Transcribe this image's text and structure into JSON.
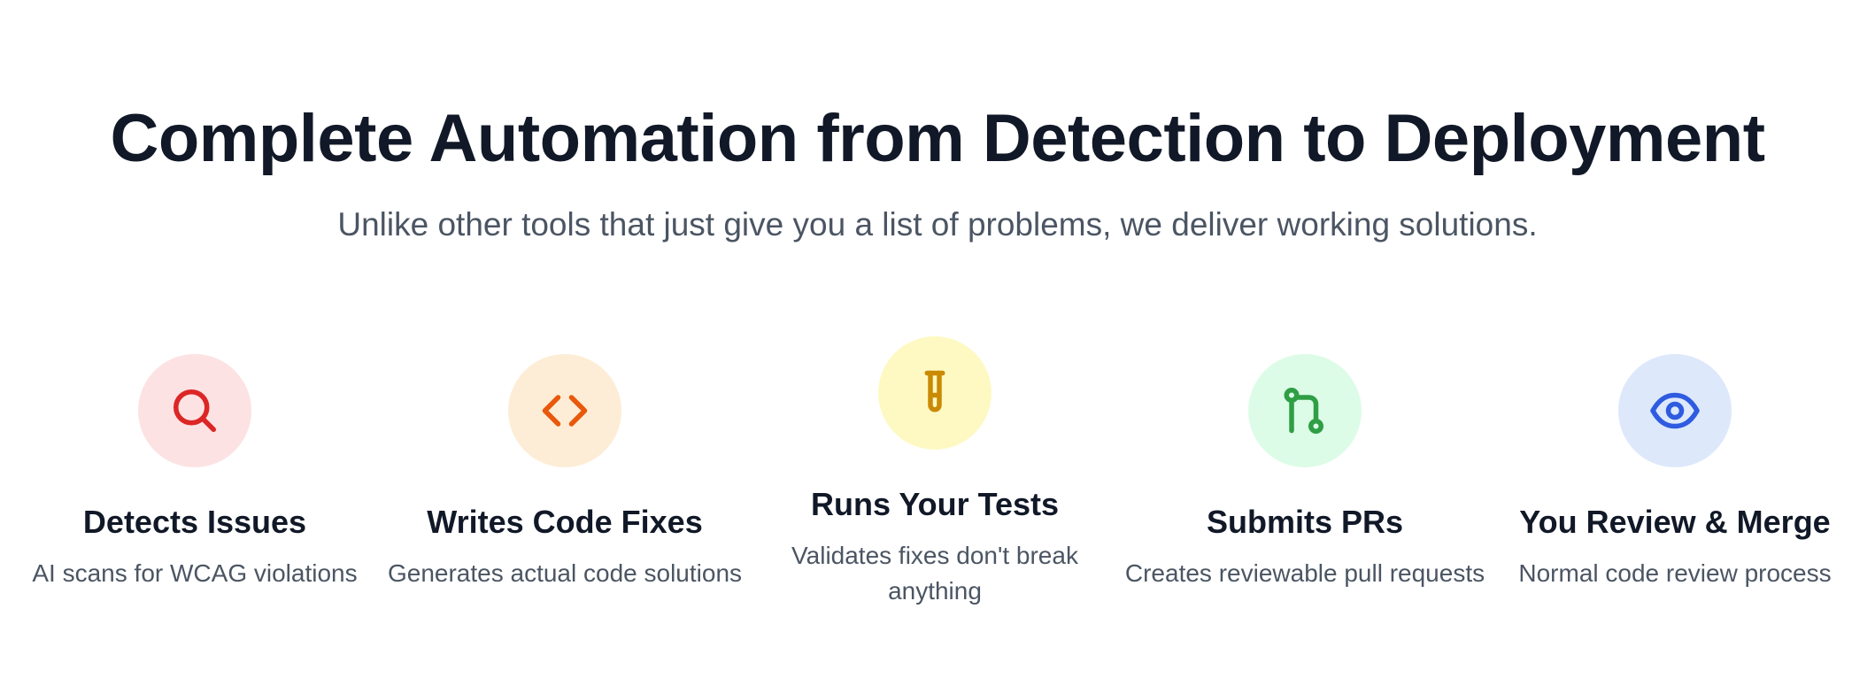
{
  "header": {
    "title": "Complete Automation from Detection to Deployment",
    "subtitle": "Unlike other tools that just give you a list of problems, we deliver working solutions."
  },
  "steps": [
    {
      "icon": "search-icon",
      "icon_color": "#dc2626",
      "bg_color": "#fde2e3",
      "title": "Detects Issues",
      "description": "AI scans for WCAG violations"
    },
    {
      "icon": "code-icon",
      "icon_color": "#e8590c",
      "bg_color": "#fdedd6",
      "title": "Writes Code Fixes",
      "description": "Generates actual code solutions"
    },
    {
      "icon": "test-tube-icon",
      "icon_color": "#ca8a04",
      "bg_color": "#fef9c3",
      "title": "Runs Your Tests",
      "description": "Validates fixes don't break anything"
    },
    {
      "icon": "git-pull-request-icon",
      "icon_color": "#2f9e44",
      "bg_color": "#dcfce7",
      "title": "Submits PRs",
      "description": "Creates reviewable pull requests"
    },
    {
      "icon": "eye-icon",
      "icon_color": "#2f5be0",
      "bg_color": "#dde8fb",
      "title": "You Review & Merge",
      "description": "Normal code review process"
    }
  ]
}
